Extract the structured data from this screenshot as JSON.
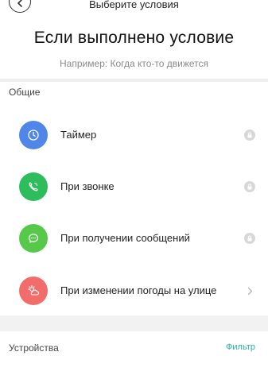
{
  "header": {
    "title": "Выберите условия",
    "back_icon": "chevron-left-icon"
  },
  "intro": {
    "heading": "Если выполнено условие",
    "subheading": "Например: Когда кто-то движется"
  },
  "general": {
    "title": "Общие",
    "items": [
      {
        "label": "Таймер",
        "icon": "clock-icon",
        "color": "#4f86e8",
        "trailing": "lock-icon"
      },
      {
        "label": "При звонке",
        "icon": "phone-icon",
        "color": "#2dbd5c",
        "trailing": "lock-icon"
      },
      {
        "label": "При получении сообщений",
        "icon": "chat-icon",
        "color": "#57c94a",
        "trailing": "lock-icon"
      },
      {
        "label": "При изменении погоды на улице",
        "icon": "weather-icon",
        "color": "#f26c6c",
        "trailing": "chevron-right-icon"
      }
    ]
  },
  "devices": {
    "title": "Устройства",
    "filter_label": "Фильтр",
    "accent": "#2bb0a0"
  }
}
